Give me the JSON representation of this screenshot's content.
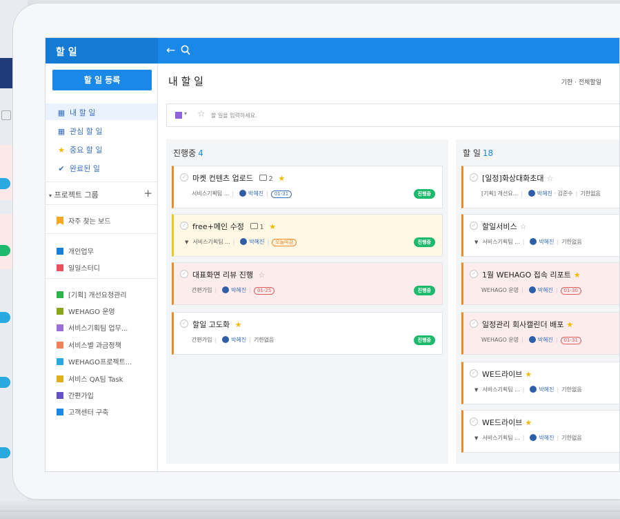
{
  "app": {
    "title": "할 일"
  },
  "sidebar": {
    "register_label": "할 일 등록",
    "nav": [
      {
        "label": "내 할 일",
        "icon": "calendar-icon"
      },
      {
        "label": "관심 할 일",
        "icon": "calendar-icon"
      },
      {
        "label": "중요 할 일",
        "icon": "star-icon"
      },
      {
        "label": "완료된 일",
        "icon": "check-circle-icon"
      }
    ],
    "project_group_label": "프로젝트 그룹",
    "favorite_board": "자주 찾는 보드",
    "personal": [
      {
        "label": "개인업무",
        "color": "#1a7fd8"
      },
      {
        "label": "일일스터디",
        "color": "#e8505b"
      }
    ],
    "projects": [
      {
        "label": "[기획] 개선요청관리",
        "color": "#2db34a"
      },
      {
        "label": "WEHAGO 운영",
        "color": "#8aa51c"
      },
      {
        "label": "서비스기획팀 업무...",
        "color": "#9b6fd8"
      },
      {
        "label": "서비스별 과금정책",
        "color": "#f0805a"
      },
      {
        "label": "WEHAGO프로젝트...",
        "color": "#2aa9e0"
      },
      {
        "label": "서비스 QA팀 Task",
        "color": "#e0b020"
      },
      {
        "label": "간편가입",
        "color": "#6650c8"
      },
      {
        "label": "고객센터 구축",
        "color": "#1a88e6"
      }
    ]
  },
  "main": {
    "title": "내 할 일",
    "filter": "기한 · 전체할일",
    "input_placeholder": "할 일을 입력하세요."
  },
  "columns": {
    "progress": {
      "title": "진행중",
      "count": "4",
      "cards": [
        {
          "title": "마켓 컨텐츠 업로드",
          "comments": "2",
          "project": "서비스기획팀 ...",
          "person": "박혜진",
          "date": "01-31",
          "status": "진행중"
        },
        {
          "title": "free+메인 수정",
          "comments": "1",
          "project": "서비스기획팀 ...",
          "person": "박혜진",
          "date": "오늘마감",
          "status": "진행중"
        },
        {
          "title": "대표화면 리뷰 진행",
          "project": "간편가입",
          "person": "박혜진",
          "date": "01-25",
          "status": "진행중"
        },
        {
          "title": "할일 고도화",
          "project": "간편가입",
          "person": "박혜진",
          "date": "기한없음",
          "status": "진행중"
        }
      ]
    },
    "todo": {
      "title": "할 일",
      "count": "18",
      "cards": [
        {
          "title": "[일정]화상대화초대",
          "project": "[기획] 개선요...",
          "person": "박혜진",
          "extra": "· 김준수",
          "date": "기한없음"
        },
        {
          "title": "할일서비스",
          "project": "서비스기획팀 ...",
          "person": "박혜진",
          "date": "기한없음"
        },
        {
          "title": "1월 WEHAGO 접속 리포트",
          "project": "WEHAGO 운영",
          "person": "박혜진",
          "date": "01-30"
        },
        {
          "title": "일정관리 회사캘린더 배포",
          "project": "WEHAGO 운영",
          "person": "박혜진",
          "date": "01-31"
        },
        {
          "title": "WE드라이브",
          "project": "서비스기획팀 ...",
          "person": "박혜진",
          "date": "기한없음"
        },
        {
          "title": "WE드라이브",
          "project": "서비스기획팀 ...",
          "person": "박혜진",
          "date": "기한없음"
        }
      ]
    }
  },
  "colors": {
    "accent": "#1a88e6",
    "status_green": "#1db96c",
    "star": "#f5b800"
  }
}
